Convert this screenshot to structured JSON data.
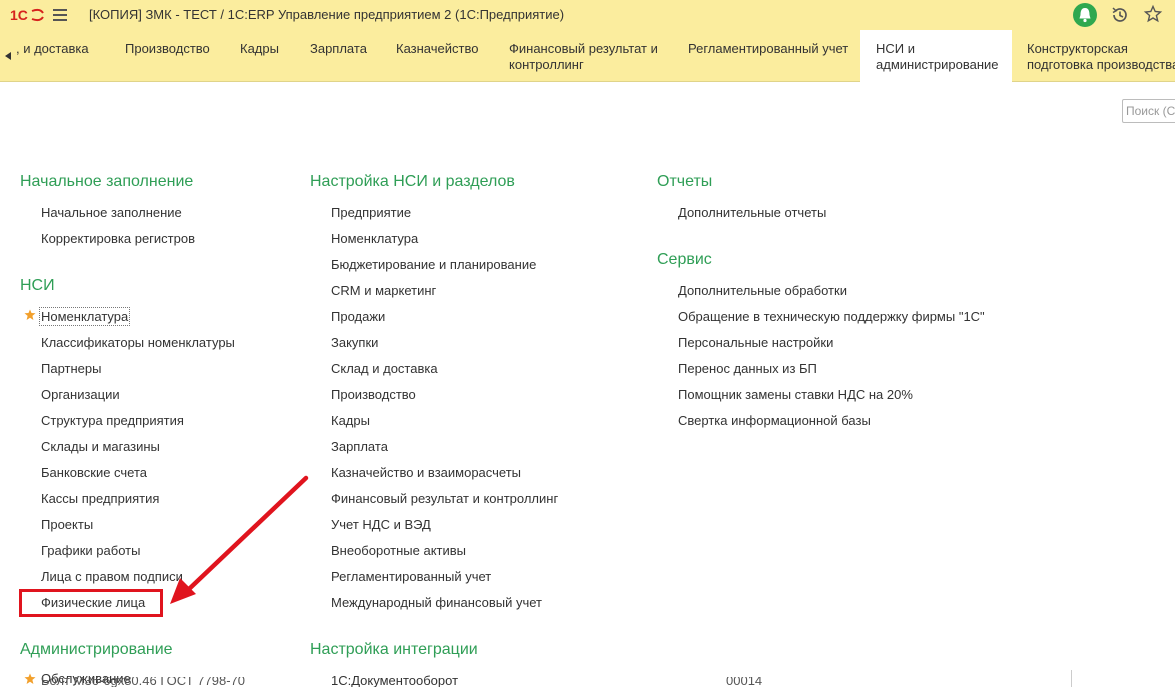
{
  "window": {
    "title": "[КОПИЯ] ЗМК - ТЕСТ / 1С:ERP Управление предприятием 2  (1С:Предприятие)"
  },
  "sections": [
    {
      "label": ", и доставка"
    },
    {
      "label": "Производство"
    },
    {
      "label": "Кадры"
    },
    {
      "label": "Зарплата"
    },
    {
      "label": "Казначейство"
    },
    {
      "label": "Финансовый результат и\nконтроллинг"
    },
    {
      "label": "Регламентированный учет"
    },
    {
      "label": "НСИ и\nадминистрирование"
    },
    {
      "label": "Конструкторская\nподготовка производства"
    }
  ],
  "search": {
    "placeholder": "Поиск (C"
  },
  "columns": {
    "col1": {
      "initial": {
        "title": "Начальное заполнение",
        "items": [
          "Начальное заполнение",
          "Корректировка регистров"
        ]
      },
      "nsi": {
        "title": "НСИ",
        "items": [
          "Номенклатура",
          "Классификаторы номенклатуры",
          "Партнеры",
          "Организации",
          "Структура предприятия",
          "Склады и магазины",
          "Банковские счета",
          "Кассы предприятия",
          "Проекты",
          "Графики работы",
          "Лица с правом подписи",
          "Физические лица"
        ]
      },
      "admin": {
        "title": "Администрирование",
        "items": [
          "Обслуживание"
        ]
      }
    },
    "col2": {
      "settings": {
        "title": "Настройка НСИ и разделов",
        "items": [
          "Предприятие",
          "Номенклатура",
          "Бюджетирование и планирование",
          "CRM и маркетинг",
          "Продажи",
          "Закупки",
          "Склад и доставка",
          "Производство",
          "Кадры",
          "Зарплата",
          "Казначейство и взаиморасчеты",
          "Финансовый результат и контроллинг",
          "Учет НДС и ВЭД",
          "Внеоборотные активы",
          "Регламентированный учет",
          "Международный финансовый учет"
        ]
      },
      "integration": {
        "title": "Настройка интеграции",
        "items": [
          "1С:Документооборот"
        ]
      }
    },
    "col3": {
      "reports": {
        "title": "Отчеты",
        "items": [
          "Дополнительные отчеты"
        ]
      },
      "service": {
        "title": "Сервис",
        "items": [
          "Дополнительные обработки",
          "Обращение в техническую поддержку фирмы \"1С\"",
          "Персональные настройки",
          "Перенос данных из БП",
          "Помощник замены ставки НДС на 20%",
          "Свертка информационной базы"
        ]
      }
    }
  },
  "overflow_text": {
    "left": "Болт М36-6gx80.46 ГОСТ 7798-70",
    "right": "00014"
  },
  "colors": {
    "toolbar": "#fbed9e",
    "group_title": "#2f9e56",
    "highlight": "#e0141e",
    "star": "#f2a02c"
  },
  "icons": {
    "logo": "1c-logo-icon",
    "menu": "hamburger-menu-icon",
    "bell": "notification-bell-icon",
    "history": "history-clock-icon",
    "favorites": "favorite-star-icon",
    "scroll": "scroll-left-icon"
  }
}
